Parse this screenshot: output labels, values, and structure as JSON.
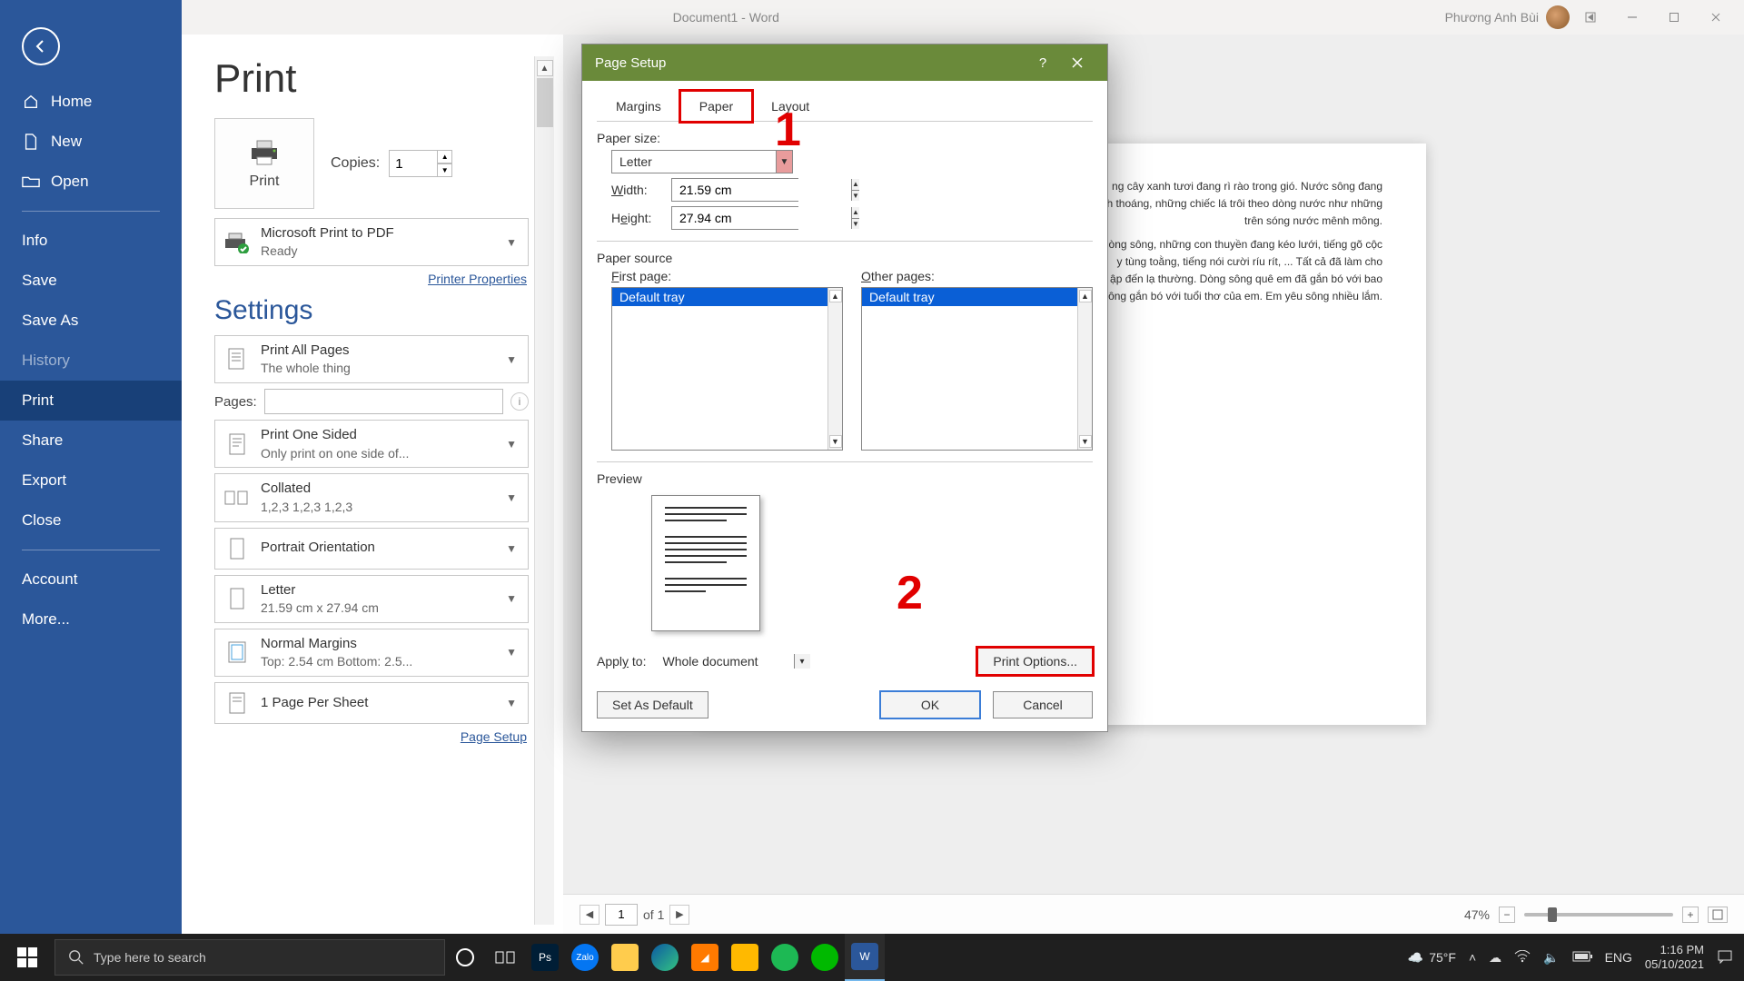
{
  "titlebar": {
    "doc": "Document1 - Word",
    "user": "Phương Anh Bùi"
  },
  "sidebar": {
    "items": [
      {
        "label": "Home",
        "icon": "home"
      },
      {
        "label": "New",
        "icon": "doc"
      },
      {
        "label": "Open",
        "icon": "open"
      }
    ],
    "items2": [
      {
        "label": "Info"
      },
      {
        "label": "Save"
      },
      {
        "label": "Save As"
      },
      {
        "label": "History",
        "dim": true
      },
      {
        "label": "Print",
        "active": true
      },
      {
        "label": "Share"
      },
      {
        "label": "Export"
      },
      {
        "label": "Close"
      }
    ],
    "items3": [
      {
        "label": "Account"
      },
      {
        "label": "More..."
      }
    ]
  },
  "print": {
    "title": "Print",
    "print_label": "Print",
    "copies_label": "Copies:",
    "copies_value": "1",
    "printer": {
      "name": "Microsoft Print to PDF",
      "status": "Ready"
    },
    "printer_props": "Printer Properties",
    "settings_title": "Settings",
    "print_all": {
      "title": "Print All Pages",
      "sub": "The whole thing"
    },
    "pages_label": "Pages:",
    "one_sided": {
      "title": "Print One Sided",
      "sub": "Only print on one side of..."
    },
    "collated": {
      "title": "Collated",
      "sub": "1,2,3    1,2,3    1,2,3"
    },
    "orient": "Portrait Orientation",
    "paper": {
      "title": "Letter",
      "sub": "21.59 cm x 27.94 cm"
    },
    "margins": {
      "title": "Normal Margins",
      "sub": "Top: 2.54 cm Bottom: 2.5..."
    },
    "per_sheet": "1 Page Per Sheet",
    "page_setup_link": "Page Setup"
  },
  "preview_doc": {
    "p1": "ng cây xanh tươi đang rì rào trong gió. Nước sông đang",
    "p2": "h thoáng, những chiếc lá trôi theo dòng nước như những",
    "p3": "trên sóng nước mênh mông.",
    "p4": "òng sông, những con thuyền đang kéo lưới, tiếng gõ cộc",
    "p5": "y tùng toằng, tiếng nói cười ríu rít, ... Tất cả đã làm cho",
    "p6": "ập đến lạ thường. Dòng sông quê em đã gắn bó với bao",
    "p7": "ông gắn bó với tuổi thơ của em. Em yêu sông nhiều lắm."
  },
  "dialog": {
    "title": "Page Setup",
    "tabs": {
      "margins": "Margins",
      "paper": "Paper",
      "layout": "Layout"
    },
    "paper_size_label": "Paper size:",
    "paper_size": "Letter",
    "width_label": "Width:",
    "width": "21.59 cm",
    "height_label": "Height:",
    "height": "27.94 cm",
    "source_label": "Paper source",
    "first_page": "First page:",
    "other_pages": "Other pages:",
    "default_tray": "Default tray",
    "preview_label": "Preview",
    "apply_to_label": "Apply to:",
    "apply_to": "Whole document",
    "print_options": "Print Options...",
    "set_default": "Set As Default",
    "ok": "OK",
    "cancel": "Cancel",
    "annot1": "1",
    "annot2": "2"
  },
  "footer": {
    "page_current": "1",
    "page_total": "of  1",
    "zoom": "47%"
  },
  "taskbar": {
    "search_placeholder": "Type here to search",
    "temp": "75°F",
    "lang": "ENG",
    "time": "1:16 PM",
    "date": "05/10/2021"
  }
}
